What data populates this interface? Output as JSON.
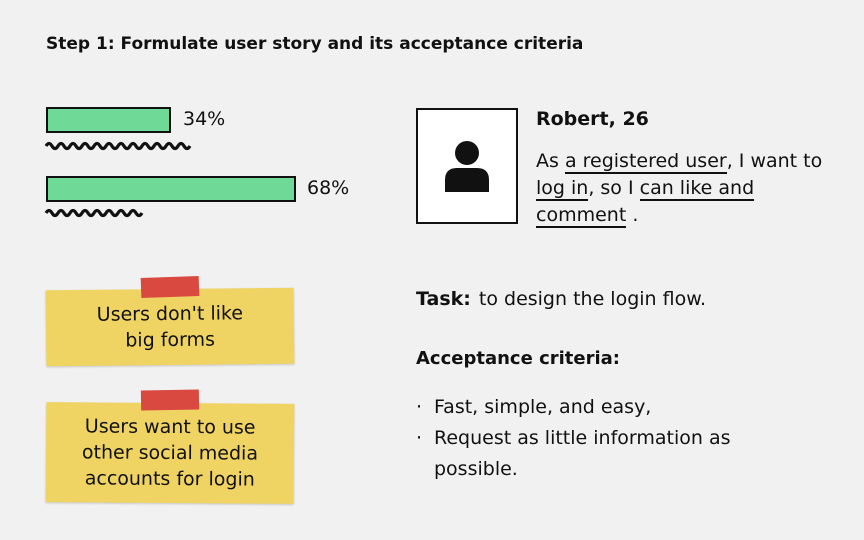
{
  "title": "Step 1: Formulate user story and its acceptance criteria",
  "stats": [
    {
      "value": 34,
      "label": "34%"
    },
    {
      "value": 68,
      "label": "68%"
    }
  ],
  "notes": [
    {
      "lines": [
        "Users don't like",
        "big forms"
      ]
    },
    {
      "lines": [
        "Users want to use",
        "other social media",
        "accounts for login"
      ]
    }
  ],
  "persona": {
    "name": "Robert, 26",
    "story": {
      "t1": "As ",
      "u1": "a registered user",
      "t2": ", I want to ",
      "u2": "log in",
      "t3": ", so I ",
      "u3": "can like and comment",
      "t4": " ."
    }
  },
  "task": {
    "label": "Task:",
    "text": "to design the login flow."
  },
  "criteria": {
    "heading": "Acceptance criteria:",
    "items": [
      "Fast, simple, and easy,",
      "Request as little information as possible."
    ]
  },
  "colors": {
    "bar": "#6fd998",
    "note": "#f0d463",
    "tape": "#d9493f",
    "background": "#f1f1f1"
  }
}
